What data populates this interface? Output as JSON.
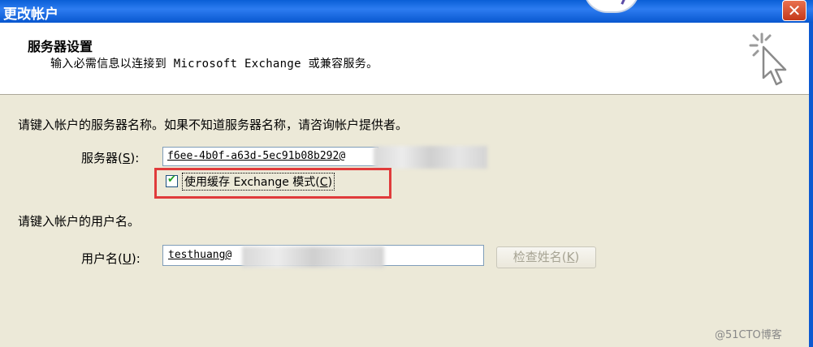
{
  "window": {
    "title": "更改帐户",
    "close_label": "✕"
  },
  "header": {
    "title": "服务器设置",
    "subtitle": "输入必需信息以连接到 Microsoft Exchange 或兼容服务。"
  },
  "server_section": {
    "instruction": "请键入帐户的服务器名称。如果不知道服务器名称，请咨询帐户提供者。",
    "server_label": "服务器(",
    "server_key": "S",
    "server_label_end": "):",
    "server_value": "f6ee-4b0f-a63d-5ec91b08b292@",
    "cache_label": "使用缓存 Exchange 模式(",
    "cache_key": "C",
    "cache_label_end": ")",
    "cache_checked": true
  },
  "user_section": {
    "instruction": "请键入帐户的用户名。",
    "user_label": "用户名(",
    "user_key": "U",
    "user_label_end": "):",
    "user_value": "testhuang@",
    "check_name_label": "检查姓名(",
    "check_name_key": "K",
    "check_name_label_end": ")"
  },
  "colors": {
    "titlebar": "#0a5fd6",
    "highlight_box": "#e03b3b",
    "dialog_bg": "#ece9d8"
  },
  "watermark": "@51CTO博客"
}
